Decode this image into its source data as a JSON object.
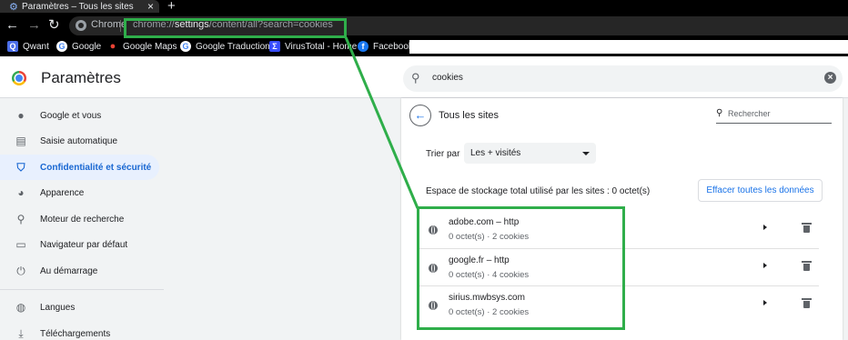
{
  "browser": {
    "tab_title": "Paramètres – Tous les sites",
    "tab_close": "×",
    "new_tab": "+",
    "omnibox_label": "Chrome",
    "url_prefix": "chrome://",
    "url_host": "settings",
    "url_path": "/content/all?search=cookies"
  },
  "bookmarks": [
    {
      "label": "Qwant",
      "icon": "qwant-icon",
      "color": "#4b6ee8"
    },
    {
      "label": "Google",
      "icon": "google-icon",
      "color": "#ffffff"
    },
    {
      "label": "Google Maps",
      "icon": "google-maps-icon",
      "color": "#ea4335"
    },
    {
      "label": "Google Traduction",
      "icon": "google-translate-icon",
      "color": "#ffffff"
    },
    {
      "label": "VirusTotal - Home",
      "icon": "virustotal-icon",
      "color": "#394eff"
    },
    {
      "label": "Facebook",
      "icon": "facebook-icon",
      "color": "#1877f2"
    }
  ],
  "header": {
    "title": "Paramètres",
    "search_value": "cookies"
  },
  "sidebar": {
    "items": [
      {
        "label": "Google et vous",
        "icon": "person-icon"
      },
      {
        "label": "Saisie automatique",
        "icon": "clipboard-icon"
      },
      {
        "label": "Confidentialité et sécurité",
        "icon": "shield-icon",
        "active": true
      },
      {
        "label": "Apparence",
        "icon": "palette-icon"
      },
      {
        "label": "Moteur de recherche",
        "icon": "search-icon"
      },
      {
        "label": "Navigateur par défaut",
        "icon": "browser-icon"
      },
      {
        "label": "Au démarrage",
        "icon": "power-icon"
      },
      {
        "label": "Langues",
        "icon": "globe-icon"
      },
      {
        "label": "Téléchargements",
        "icon": "download-icon"
      }
    ]
  },
  "main": {
    "title": "Tous les sites",
    "site_search_placeholder": "Rechercher",
    "sort_label": "Trier par",
    "sort_value": "Les + visités",
    "storage_text": "Espace de stockage total utilisé par les sites : 0 octet(s)",
    "clear_button": "Effacer toutes les données",
    "sites": [
      {
        "name": "adobe.com – http",
        "meta": "0 octet(s) · 2 cookies"
      },
      {
        "name": "google.fr – http",
        "meta": "0 octet(s) · 4 cookies"
      },
      {
        "name": "sirius.mwbsys.com",
        "meta": "0 octet(s) · 2 cookies"
      }
    ]
  },
  "colors": {
    "annotation": "#2fae4a",
    "accent": "#1a73e8",
    "active_bg": "#e8f0fe"
  }
}
